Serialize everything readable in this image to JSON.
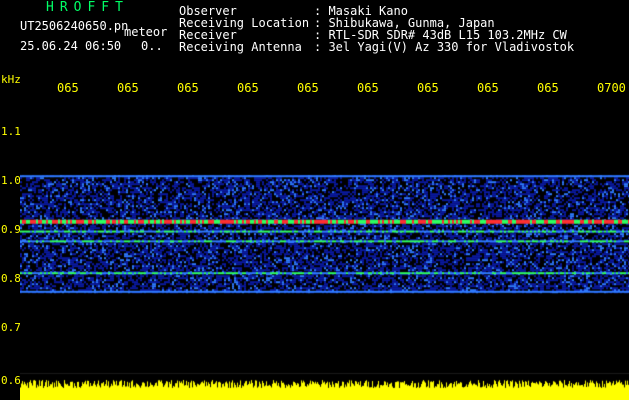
{
  "header": {
    "brand": "HROFFT",
    "filename": "UT2506240650.pn",
    "mode": "meteor",
    "date_time": "25.06.24 06:50",
    "counter": "0..",
    "info": [
      {
        "label": "Observer",
        "value": ": Masaki Kano"
      },
      {
        "label": "Receiving Location",
        "value": ": Shibukawa, Gunma, Japan"
      },
      {
        "label": "Receiver",
        "value": ": RTL-SDR SDR# 43dB L15 103.2MHz CW"
      },
      {
        "label": "Receiving Antenna",
        "value": ": 3el Yagi(V) Az 330 for Vladivostok"
      }
    ]
  },
  "chart_data": {
    "type": "heatmap",
    "ylabel": "kHz",
    "y_ticks": [
      "1.1",
      "1.0",
      "0.9",
      "0.8",
      "0.7",
      "0.6"
    ],
    "y_tick_values": [
      1.1,
      1.0,
      0.9,
      0.8,
      0.7,
      0.6
    ],
    "x_ticks": [
      "065",
      "065",
      "065",
      "065",
      "065",
      "065",
      "065",
      "065",
      "065",
      "0700"
    ],
    "ylim": [
      0.6,
      1.2
    ],
    "noise_band_khz": [
      0.78,
      1.02
    ],
    "strong_lines_khz": [
      0.925,
      0.905,
      0.885,
      0.82
    ],
    "colors": {
      "background": "#000000",
      "noise_low": "#0a1aa0",
      "noise_mid": "#2f7bff",
      "line_signal": "#ff3030",
      "line_green": "#30ff60",
      "power_trace": "#ffff00",
      "label_yellow": "#ffff00",
      "brand_green": "#00ff66"
    }
  }
}
